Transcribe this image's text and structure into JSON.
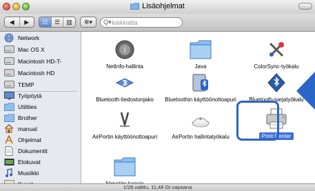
{
  "window": {
    "title": "Lisäohjelmat"
  },
  "toolbar": {
    "back_label": "◀",
    "forward_label": "▶",
    "view_icon_label": "☷",
    "view_list_label": "☰",
    "view_column_label": "▥",
    "action_label": "✲▾",
    "search_placeholder": "kaikkialta"
  },
  "sidebar": {
    "devices": [
      {
        "label": "Network",
        "icon": "network-icon"
      },
      {
        "label": "Mac OS X",
        "icon": "disk-icon"
      },
      {
        "label": "Macintosh HD-T-",
        "icon": "disk-icon"
      },
      {
        "label": "Macintosh HD",
        "icon": "disk-icon"
      },
      {
        "label": "TEMP",
        "icon": "disk-icon"
      }
    ],
    "places": [
      {
        "label": "Työpöytä",
        "icon": "desktop-icon"
      },
      {
        "label": "Utilities",
        "icon": "folder-icon"
      },
      {
        "label": "Brother",
        "icon": "folder-icon"
      },
      {
        "label": "manual",
        "icon": "home-icon"
      },
      {
        "label": "Ohjelmat",
        "icon": "applications-icon"
      },
      {
        "label": "Dokumentit",
        "icon": "documents-icon"
      },
      {
        "label": "Elokuvat",
        "icon": "movies-icon"
      },
      {
        "label": "Musiikki",
        "icon": "music-icon"
      },
      {
        "label": "Kuvat",
        "icon": "pictures-icon"
      }
    ]
  },
  "items": [
    {
      "label": "NetInfo-hallinta",
      "icon": "netinfo-icon"
    },
    {
      "label": "Java",
      "icon": "folder-icon"
    },
    {
      "label": "ColorSync-työkalu",
      "icon": "colorsync-icon"
    },
    {
      "label": "Bluetooth-tiedostonjako",
      "icon": "bluetooth-icon"
    },
    {
      "label": "Bluetoothin käyttöönottoapuri",
      "icon": "bluetooth-setup-icon"
    },
    {
      "label": "Bluetooth-sarjatyökalu",
      "icon": "bluetooth-serial-icon"
    },
    {
      "label": "AirPortin käyttöönottoapuri",
      "icon": "airport-setup-icon"
    },
    {
      "label": "AirPortin hallintatyökalu",
      "icon": "airport-admin-icon"
    },
    {
      "label": "Print Center",
      "icon": "printer-icon",
      "selected": true
    },
    {
      "label": "Nimetön kansio",
      "icon": "folder-icon"
    }
  ],
  "status": {
    "text": "1/28 valittu, 11,48 Gt vapaana"
  },
  "colors": {
    "accent": "#2a65c8",
    "sidebar_bg": "#e6eaf0",
    "selection": "#3d6fd6"
  }
}
